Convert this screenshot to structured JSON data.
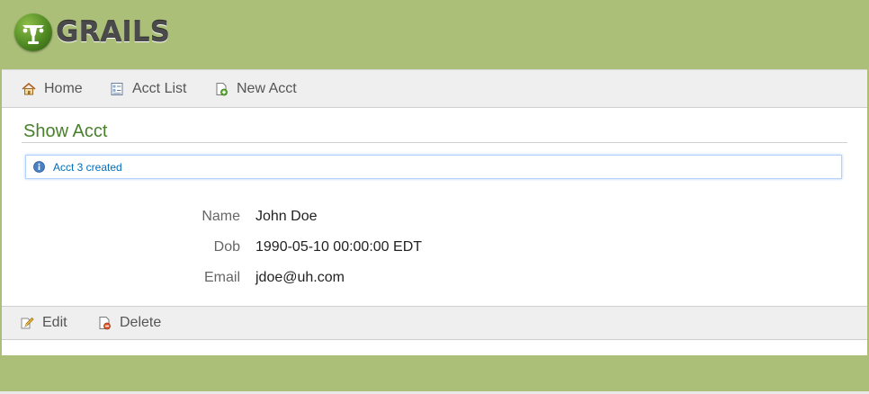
{
  "header": {
    "logo_text": "GRAILS"
  },
  "nav": {
    "items": [
      {
        "label": "Home",
        "icon": "home-icon"
      },
      {
        "label": "Acct List",
        "icon": "list-icon"
      },
      {
        "label": "New Acct",
        "icon": "new-document-icon"
      }
    ]
  },
  "main": {
    "title": "Show Acct",
    "message": "Acct 3 created",
    "properties": [
      {
        "label": "Name",
        "value": "John Doe"
      },
      {
        "label": "Dob",
        "value": "1990-05-10 00:00:00 EDT"
      },
      {
        "label": "Email",
        "value": "jdoe@uh.com"
      }
    ]
  },
  "buttons": {
    "edit_label": "Edit",
    "delete_label": "Delete"
  },
  "colors": {
    "brand_green": "#abbf78",
    "title_green": "#48802c",
    "message_blue": "#006dba"
  }
}
